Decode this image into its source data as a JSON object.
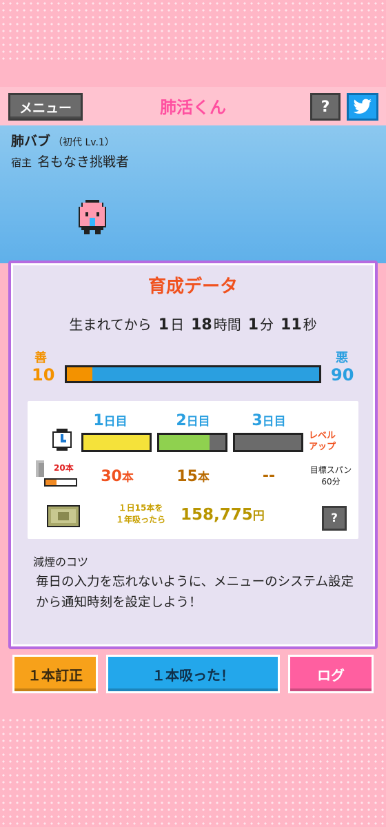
{
  "header": {
    "menu_label": "メニュー",
    "title": "肺活くん",
    "help_label": "?",
    "twitter_icon": "twitter-bird-icon"
  },
  "character": {
    "name": "肺バブ",
    "sub": "（初代 Lv.1）",
    "host_label": "宿主",
    "host_name": "名もなき挑戦者"
  },
  "panel": {
    "title": "育成データ",
    "since_prefix": "生まれてから",
    "days": "1",
    "days_unit": "日",
    "hours": "18",
    "hours_unit": "時間",
    "minutes": "1",
    "minutes_unit": "分",
    "seconds": "11",
    "seconds_unit": "秒"
  },
  "balance": {
    "good_label": "善",
    "good_value": "10",
    "evil_label": "悪",
    "evil_value": "90",
    "good_fraction": 0.1,
    "good_color": "#f39200",
    "evil_color": "#2a9fe0"
  },
  "days": [
    {
      "num": "1",
      "unit": "日目",
      "progress": 1.0,
      "color": "#f5e23a",
      "count": "30",
      "count_unit": "本",
      "count_color": "#f0521f"
    },
    {
      "num": "2",
      "unit": "日目",
      "progress": 0.76,
      "color": "#8fd14f",
      "count": "15",
      "count_unit": "本",
      "count_color": "#b86a00"
    },
    {
      "num": "3",
      "unit": "日目",
      "progress": 0.0,
      "color": "#6b6b6b",
      "count": "--",
      "count_unit": "",
      "count_color": "#b86a00"
    }
  ],
  "levelup": {
    "line1": "レベル",
    "line2": "アップ"
  },
  "cig": {
    "pack_count": "20本"
  },
  "target": {
    "line1": "目標スパン",
    "line2": "60分"
  },
  "money": {
    "note_line1": "１日15本を",
    "note_line2": "１年吸ったら",
    "amount": "158,775",
    "unit": "円",
    "help_label": "?"
  },
  "tip": {
    "title": "減煙のコツ",
    "text": "毎日の入力を忘れないように、メニューのシステム設定から通知時刻を設定しよう！"
  },
  "buttons": {
    "correct": "１本訂正",
    "smoked": "１本吸った！",
    "log": "ログ"
  }
}
